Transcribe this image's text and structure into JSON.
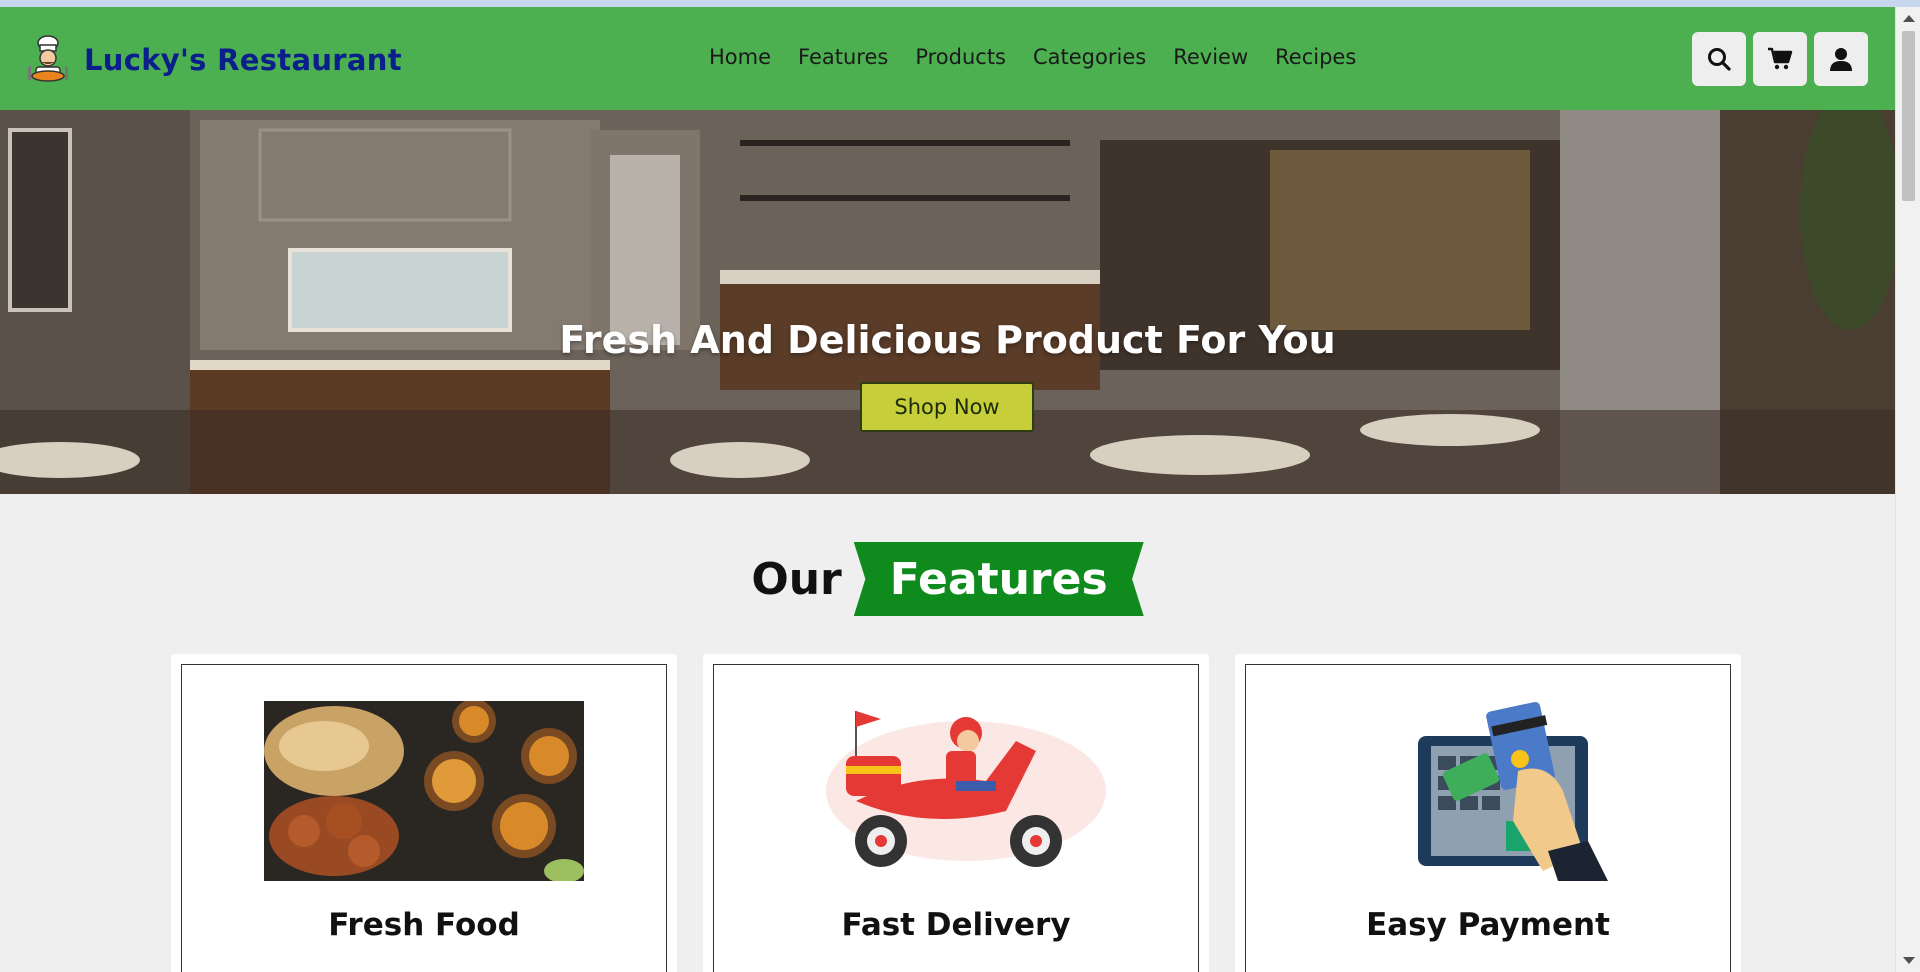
{
  "brand": {
    "name": "Lucky's Restaurant",
    "logo_icon": "chef-icon"
  },
  "nav": {
    "items": [
      "Home",
      "Features",
      "Products",
      "Categories",
      "Review",
      "Recipes"
    ]
  },
  "header_actions": [
    {
      "name": "search-icon"
    },
    {
      "name": "cart-icon"
    },
    {
      "name": "user-icon"
    }
  ],
  "hero": {
    "title": "Fresh And Delicious Product For You",
    "button_label": "Shop Now"
  },
  "features_section": {
    "heading_plain": "Our",
    "heading_highlight": "Features",
    "cards": [
      {
        "title": "Fresh Food"
      },
      {
        "title": "Fast Delivery"
      },
      {
        "title": "Easy Payment"
      }
    ]
  },
  "colors": {
    "header_bg": "#4caf50",
    "brand_text": "#0b1f8c",
    "badge_bg": "#0f8a1c",
    "shop_button": "#c6cf3a"
  }
}
